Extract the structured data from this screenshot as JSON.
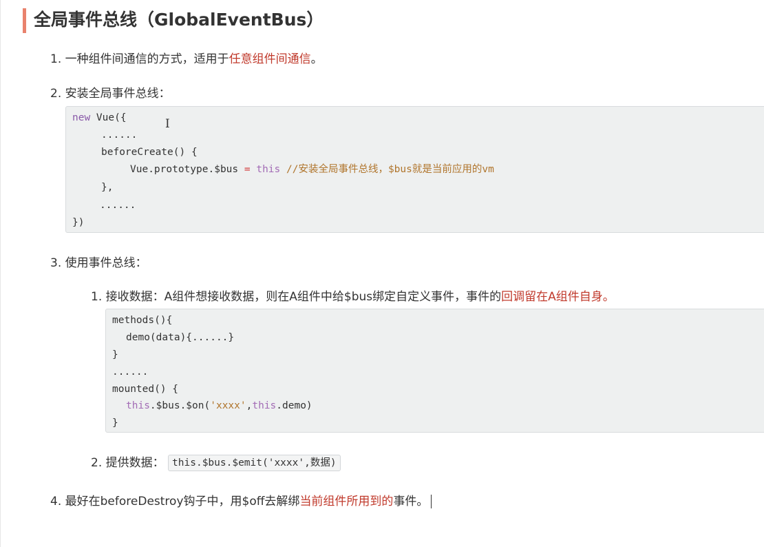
{
  "title": "全局事件总线（GlobalEventBus）",
  "items": [
    {
      "num": "1.",
      "text_a": "一种组件间通信的方式，适用于",
      "highlight": "任意组件间通信",
      "text_b": "。"
    },
    {
      "num": "2.",
      "text": "安装全局事件总线："
    },
    {
      "num": "3.",
      "text": "使用事件总线："
    },
    {
      "num": "4.",
      "text_a": "最好在beforeDestroy钩子中，用$off去解绑",
      "highlight": "当前组件所用到的",
      "text_b": "事件。"
    }
  ],
  "code1": {
    "l1_kw": "new",
    "l1_rest": " Vue({",
    "l2": "......",
    "l3": "beforeCreate() {",
    "l4_a": "Vue.prototype.$bus",
    "l4_eq": " = ",
    "l4_this": "this",
    "l4_cmt": " //安装全局事件总线，$bus就是当前应用的vm",
    "l5": "},",
    "l6": "......",
    "l7": "})"
  },
  "sub": [
    {
      "num": "1.",
      "text_a": "接收数据：A组件想接收数据，则在A组件中给$bus绑定自定义事件，事件的",
      "highlight": "回调留在A组件自身。"
    },
    {
      "num": "2.",
      "text": "提供数据：",
      "code": "this.$bus.$emit('xxxx',数据)"
    }
  ],
  "code2": {
    "l1": "methods(){",
    "l2": "demo(data){......}",
    "l3": "}",
    "l4": "......",
    "l5": "mounted() {",
    "l6_this": "this",
    "l6_a": ".$bus.$on(",
    "l6_str": "'xxxx'",
    "l6_b": ",",
    "l6_this2": "this",
    "l6_c": ".demo)",
    "l7": "}"
  },
  "cursor_glyph": "I",
  "colors": {
    "accent_bar": "#e9826d",
    "highlight": "#c0392b",
    "code_bg": "#eef0f0"
  }
}
